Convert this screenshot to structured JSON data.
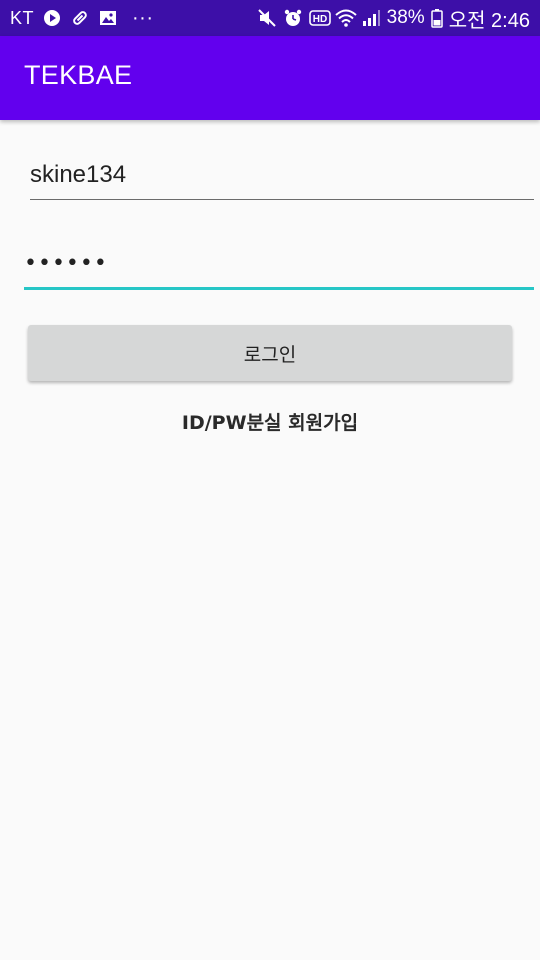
{
  "status_bar": {
    "carrier": "KT",
    "left_icons": [
      "play-circle-icon",
      "pill-icon",
      "image-icon",
      "more-dots-icon"
    ],
    "right_icons": [
      "mute-icon",
      "alarm-icon",
      "hd-icon",
      "wifi-icon",
      "signal-icon",
      "battery-icon"
    ],
    "more_dots": "···",
    "hd_label": "HD",
    "battery_percent": "38%",
    "time": "오전 2:46"
  },
  "app_bar": {
    "title": "TEKBAE",
    "background": "#6200ee",
    "status_bar_background": "#3d0fa8"
  },
  "login_form": {
    "id_value": "skine134",
    "password_value": "••••••",
    "password_underline_color": "#26c6c6",
    "login_button_label": "로그인",
    "find_account_link": "ID/PW분실",
    "signup_link": "회원가입"
  }
}
